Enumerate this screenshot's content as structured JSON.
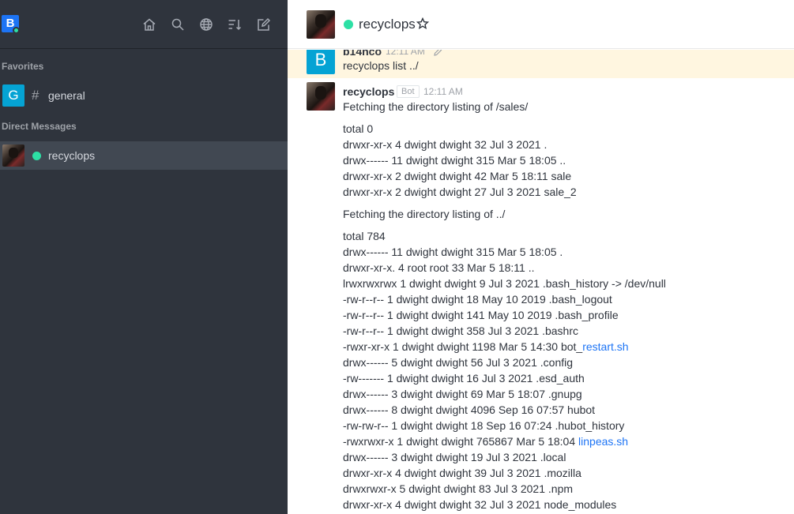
{
  "sidebar": {
    "user_initial": "B",
    "favorites_title": "Favorites",
    "direct_messages_title": "Direct Messages",
    "rooms": [
      {
        "initial": "G",
        "name": "general",
        "avatar_color": "#05a3d4"
      },
      {
        "name": "recyclops",
        "status_color": "#2de0a5"
      }
    ],
    "toolbar_icons": [
      "home-icon",
      "search-icon",
      "globe-icon",
      "sort-icon",
      "edit-icon"
    ]
  },
  "header": {
    "title": "recyclops"
  },
  "messages": {
    "highlighted": {
      "initial": "B",
      "username": "b14nco",
      "time": "12:11 AM",
      "text": "recyclops list ../"
    },
    "bot": {
      "username": "recyclops",
      "tag": "Bot",
      "time": "12:11 AM",
      "intro1": "Fetching the directory listing of /sales/",
      "listing1": [
        "total 0",
        "drwxr-xr-x 4 dwight dwight 32 Jul 3 2021 .",
        "drwx------ 11 dwight dwight 315 Mar 5 18:05 ..",
        "drwxr-xr-x 2 dwight dwight 42 Mar 5 18:11 sale",
        "drwxr-xr-x 2 dwight dwight 27 Jul 3 2021 sale_2"
      ],
      "intro2": "Fetching the directory listing of ../",
      "listing2_part1": [
        "total 784",
        "drwx------ 11 dwight dwight 315 Mar 5 18:05 .",
        "drwxr-xr-x. 4 root root 33 Mar 5 18:11 ..",
        "lrwxrwxrwx 1 dwight dwight 9 Jul 3 2021 .bash_history -> /dev/null",
        "-rw-r--r-- 1 dwight dwight 18 May 10 2019 .bash_logout",
        "-rw-r--r-- 1 dwight dwight 141 May 10 2019 .bash_profile",
        "-rw-r--r-- 1 dwight dwight 358 Jul 3 2021 .bashrc"
      ],
      "restart_prefix": "-rwxr-xr-x 1 dwight dwight 1198 Mar 5 14:30 bot_",
      "restart_link": "restart.sh",
      "listing2_part2": [
        "drwx------ 5 dwight dwight 56 Jul 3 2021 .config",
        "-rw------- 1 dwight dwight 16 Jul 3 2021 .esd_auth",
        "drwx------ 3 dwight dwight 69 Mar 5 18:07 .gnupg",
        "drwx------ 8 dwight dwight 4096 Sep 16 07:57 hubot",
        "-rw-rw-r-- 1 dwight dwight 18 Sep 16 07:24 .hubot_history"
      ],
      "linpeas_prefix": "-rwxrwxr-x 1 dwight dwight 765867 Mar 5 18:04 ",
      "linpeas_link": "linpeas.sh",
      "listing2_part3": [
        "drwx------ 3 dwight dwight 19 Jul 3 2021 .local",
        "drwxr-xr-x 4 dwight dwight 39 Jul 3 2021 .mozilla",
        "drwxrwxr-x 5 dwight dwight 83 Jul 3 2021 .npm",
        "drwxr-xr-x 4 dwight dwight 32 Jul 3 2021 node_modules"
      ]
    }
  }
}
